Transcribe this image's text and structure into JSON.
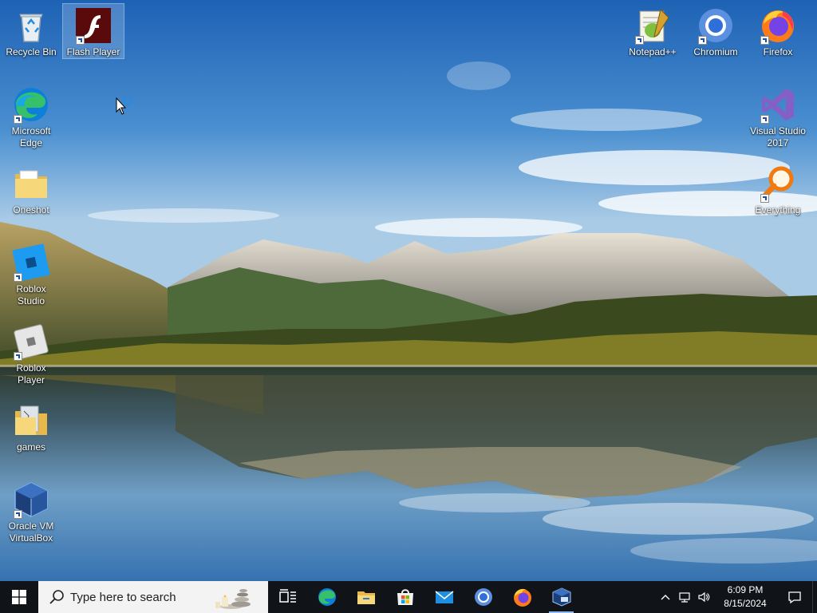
{
  "desktop": {
    "icons_left": [
      {
        "label": "Recycle Bin"
      },
      {
        "label": "Flash Player",
        "selected": true
      },
      {
        "label": "Microsoft Edge"
      },
      {
        "label": "Oneshot"
      },
      {
        "label": "Roblox Studio"
      },
      {
        "label": "Roblox Player"
      },
      {
        "label": "games"
      },
      {
        "label": "Oracle VM VirtualBox"
      }
    ],
    "icons_right": [
      {
        "label": "Notepad++"
      },
      {
        "label": "Chromium"
      },
      {
        "label": "Firefox"
      },
      {
        "label": "Visual Studio 2017"
      },
      {
        "label": "Everything"
      }
    ]
  },
  "taskbar": {
    "search": {
      "placeholder": "Type here to search"
    },
    "apps": [
      {
        "icon": "task-view-icon"
      },
      {
        "icon": "edge-icon"
      },
      {
        "icon": "file-explorer-icon"
      },
      {
        "icon": "microsoft-store-icon"
      },
      {
        "icon": "mail-icon"
      },
      {
        "icon": "chromium-icon"
      },
      {
        "icon": "firefox-icon"
      },
      {
        "icon": "virtualbox-icon"
      }
    ],
    "tray": {
      "time": "6:09 PM",
      "date": "8/15/2024"
    }
  },
  "colors": {
    "taskbar_bg": "#101418",
    "accent": "#0078d7",
    "flash_red": "#5a0a0a"
  }
}
